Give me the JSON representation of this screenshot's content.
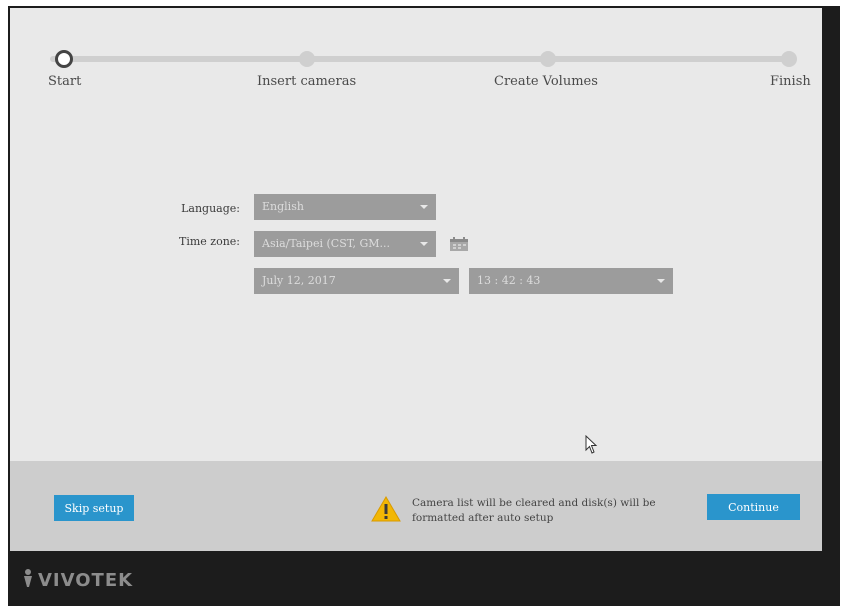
{
  "stepper": {
    "steps": [
      {
        "label": "Start"
      },
      {
        "label": "Insert cameras"
      },
      {
        "label": "Create Volumes"
      },
      {
        "label": "Finish"
      }
    ]
  },
  "form": {
    "language_label": "Language:",
    "language_value": "English",
    "timezone_label": "Time zone:",
    "timezone_value": "Asia/Taipei (CST, GM...",
    "date_value": "July 12, 2017",
    "time_value": "13 : 42 : 43"
  },
  "footer": {
    "skip_label": "Skip setup",
    "warning": "Camera list will be cleared and disk(s) will be formatted after auto setup",
    "continue_label": "Continue"
  },
  "brand": {
    "logo": "VIVOTEK"
  },
  "colors": {
    "accent": "#2a95cc",
    "warning": "#f2b705"
  }
}
